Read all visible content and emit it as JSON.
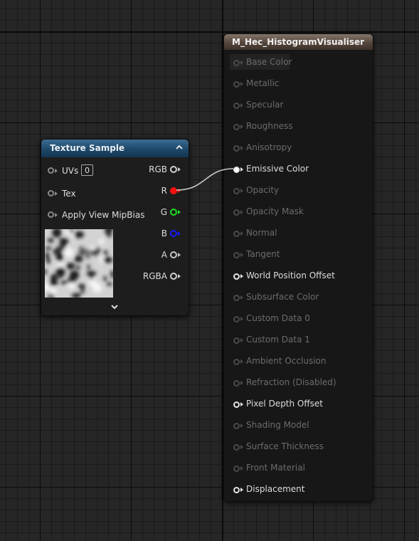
{
  "texture_node": {
    "title": "Texture Sample",
    "inputs": [
      {
        "label": "UVs",
        "value": "0"
      },
      {
        "label": "Tex"
      },
      {
        "label": "Apply View MipBias"
      }
    ],
    "outputs": [
      {
        "label": "RGB",
        "color": "#d0d0d0"
      },
      {
        "label": "R",
        "color": "#ff1010"
      },
      {
        "label": "G",
        "color": "#20e020"
      },
      {
        "label": "B",
        "color": "#1a1aff"
      },
      {
        "label": "A",
        "color": "#c8c8c8"
      },
      {
        "label": "RGBA",
        "color": "#d0d0d0"
      }
    ],
    "icons": {
      "collapse": "chevron-up-icon",
      "expand": "chevron-down-icon"
    }
  },
  "material_node": {
    "title": "M_Hec_HistogramVisualiser",
    "inputs": [
      {
        "label": "Base Color",
        "active": false
      },
      {
        "label": "Metallic",
        "active": false
      },
      {
        "label": "Specular",
        "active": false
      },
      {
        "label": "Roughness",
        "active": false
      },
      {
        "label": "Anisotropy",
        "active": false
      },
      {
        "label": "Emissive Color",
        "active": true,
        "connected": true
      },
      {
        "label": "Opacity",
        "active": false
      },
      {
        "label": "Opacity Mask",
        "active": false
      },
      {
        "label": "Normal",
        "active": false
      },
      {
        "label": "Tangent",
        "active": false
      },
      {
        "label": "World Position Offset",
        "active": true
      },
      {
        "label": "Subsurface Color",
        "active": false
      },
      {
        "label": "Custom Data 0",
        "active": false
      },
      {
        "label": "Custom Data 1",
        "active": false
      },
      {
        "label": "Ambient Occlusion",
        "active": false
      },
      {
        "label": "Refraction (Disabled)",
        "active": false
      },
      {
        "label": "Pixel Depth Offset",
        "active": true
      },
      {
        "label": "Shading Model",
        "active": false
      },
      {
        "label": "Surface Thickness",
        "active": false
      },
      {
        "label": "Front Material",
        "active": false
      },
      {
        "label": "Displacement",
        "active": true
      }
    ]
  },
  "colors": {
    "graph_background": "#262626",
    "texture_header": "#1d4869",
    "material_header": "#56473d",
    "wire": "#c8c8c8"
  }
}
